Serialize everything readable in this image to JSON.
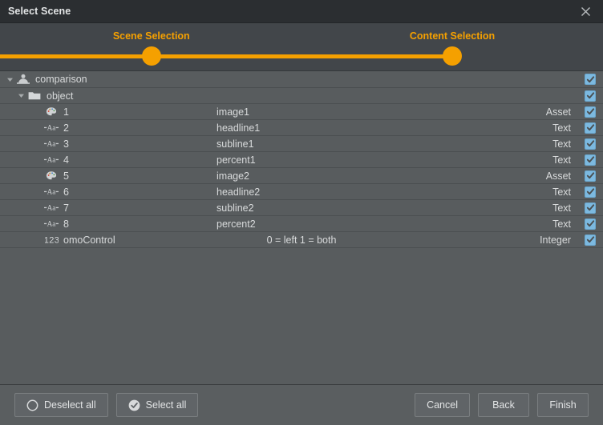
{
  "window": {
    "title": "Select Scene",
    "close_icon": "close-icon"
  },
  "stepper": {
    "steps": [
      {
        "label": "Scene Selection",
        "x_percent": 25.1,
        "state": "active"
      },
      {
        "label": "Content Selection",
        "x_percent": 75.0,
        "state": "active"
      }
    ],
    "accent_color": "#f5a000",
    "line_color": "#f5a000"
  },
  "tree": {
    "rows": [
      {
        "indent": 0,
        "twisty": "chevron-down-icon",
        "icon": "scene-icon",
        "name": "comparison",
        "value": "",
        "type": "",
        "checked": true
      },
      {
        "indent": 1,
        "twisty": "chevron-down-icon",
        "icon": "folder-icon",
        "name": "object",
        "value": "",
        "type": "",
        "checked": true
      },
      {
        "indent": 2,
        "twisty": "",
        "icon": "asset-image-icon",
        "name": "1",
        "value": "image1",
        "type": "Asset",
        "checked": true
      },
      {
        "indent": 2,
        "twisty": "",
        "icon": "text-icon",
        "name": "2",
        "value": "headline1",
        "type": "Text",
        "checked": true
      },
      {
        "indent": 2,
        "twisty": "",
        "icon": "text-icon",
        "name": "3",
        "value": "subline1",
        "type": "Text",
        "checked": true
      },
      {
        "indent": 2,
        "twisty": "",
        "icon": "text-icon",
        "name": "4",
        "value": "percent1",
        "type": "Text",
        "checked": true
      },
      {
        "indent": 2,
        "twisty": "",
        "icon": "asset-image-icon",
        "name": "5",
        "value": "image2",
        "type": "Asset",
        "checked": true
      },
      {
        "indent": 2,
        "twisty": "",
        "icon": "text-icon",
        "name": "6",
        "value": "headline2",
        "type": "Text",
        "checked": true
      },
      {
        "indent": 2,
        "twisty": "",
        "icon": "text-icon",
        "name": "7",
        "value": "subline2",
        "type": "Text",
        "checked": true
      },
      {
        "indent": 2,
        "twisty": "",
        "icon": "text-icon",
        "name": "8",
        "value": "percent2",
        "type": "Text",
        "checked": true
      },
      {
        "indent": 2,
        "twisty": "",
        "icon": "integer-icon",
        "name": "omoControl",
        "value": "0 = left 1 = both",
        "type": "Integer",
        "checked": true
      }
    ]
  },
  "footer": {
    "deselect_all_label": "Deselect all",
    "select_all_label": "Select all",
    "cancel_label": "Cancel",
    "back_label": "Back",
    "finish_label": "Finish"
  }
}
